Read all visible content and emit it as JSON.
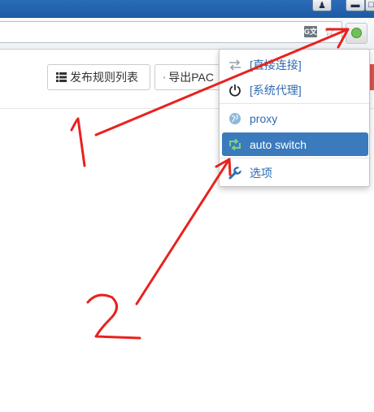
{
  "window": {
    "user_glyph": "♟",
    "min_glyph": "▬",
    "max_glyph": "□"
  },
  "toolbar": {
    "translate_label": "G文",
    "bookmark_star": "☆"
  },
  "page": {
    "publish_button": "发布规则列表",
    "export_button": "导出PAC",
    "publish_icon": "list-icon",
    "export_icon": "download-icon"
  },
  "menu": {
    "items": [
      {
        "label": "[直接连接]",
        "icon": "direct-connect-icon"
      },
      {
        "label": "[系统代理]",
        "icon": "power-icon"
      },
      {
        "label": "proxy",
        "icon": "globe-icon"
      },
      {
        "label": "auto switch",
        "icon": "retweet-icon",
        "selected": true
      },
      {
        "label": "选项",
        "icon": "wrench-icon"
      }
    ]
  },
  "colors": {
    "accent": "#3a7abd",
    "menu_text": "#2f6bb0",
    "annotation": "#e8221e",
    "titlebar": "#1d5aa5",
    "danger_edge": "#d9534f"
  }
}
